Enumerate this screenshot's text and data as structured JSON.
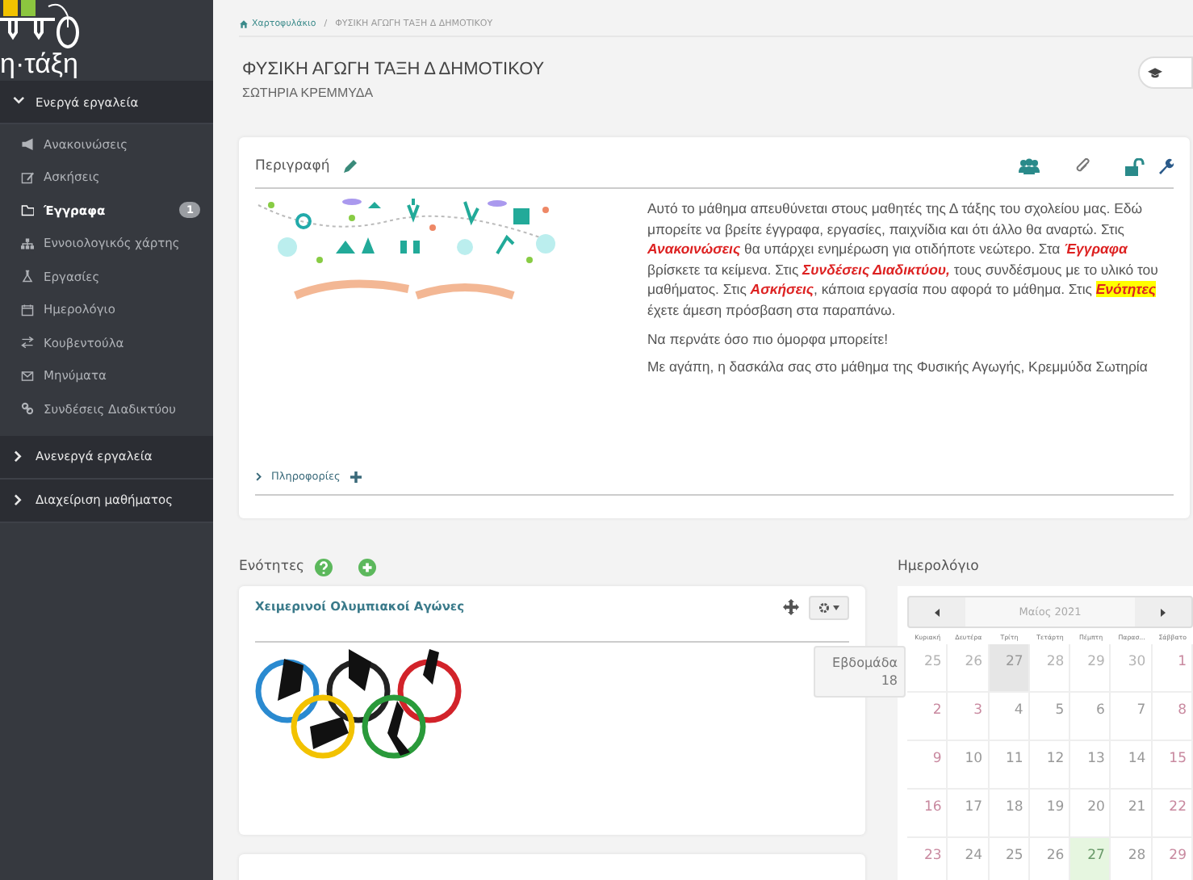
{
  "sidebar": {
    "logo_text": "η·τάξη",
    "sections": [
      {
        "label": "Ενεργά εργαλεία",
        "expanded": true,
        "items": [
          {
            "label": "Ανακοινώσεις",
            "selected": false
          },
          {
            "label": "Ασκήσεις",
            "selected": false
          },
          {
            "label": "Έγγραφα",
            "selected": true,
            "badge": "1"
          },
          {
            "label": "Εννοιολογικός χάρτης",
            "selected": false
          },
          {
            "label": "Εργασίες",
            "selected": false
          },
          {
            "label": "Ημερολόγιο",
            "selected": false
          },
          {
            "label": "Κουβεντούλα",
            "selected": false
          },
          {
            "label": "Μηνύματα",
            "selected": false
          },
          {
            "label": "Συνδέσεις Διαδικτύου",
            "selected": false
          }
        ]
      },
      {
        "label": "Ανενεργά εργαλεία",
        "expanded": false
      },
      {
        "label": "Διαχείριση μαθήματος",
        "expanded": false
      }
    ]
  },
  "breadcrumb": [
    {
      "label": "Χαρτοφυλάκιο"
    },
    {
      "label": "ΦΥΣΙΚΗ ΑΓΩΓΗ ΤΑΞΗ Δ ΔΗΜΟΤΙΚΟΥ",
      "separator": "/"
    }
  ],
  "student_view": {
    "on": false
  },
  "course": {
    "title": "ΦΥΣΙΚΗ ΑΓΩΓΗ ΤΑΞΗ Δ ΔΗΜΟΤΙΚΟΥ",
    "teacher": "ΣΩΤΗΡΙΑ ΚΡΕΜΜΥΔΑ"
  },
  "description": {
    "heading": "Περιγραφή",
    "paragraphs": [
      [
        {
          "kind": "plain",
          "text": "Αυτό το μάθημα απευθύνεται στους μαθητές της Δ τάξης του σχολείου μας. Εδώ μπορείτε να βρείτε έγγραφα, εργασίες, παιχνίδια και ότι άλλο θα αναρτώ. Στις "
        },
        {
          "kind": "emphasis",
          "text": "Ανακοινώσεις"
        },
        {
          "kind": "plain",
          "text": " θα υπάρχει ενημέρωση για οτιδήποτε νεώτερο. Στα "
        },
        {
          "kind": "emphasis",
          "text": "Έγγραφα"
        },
        {
          "kind": "plain",
          "text": " βρίσκετε τα κείμενα. Στις "
        },
        {
          "kind": "emphasis",
          "text": "Συνδέσεις Διαδικτύου,"
        },
        {
          "kind": "plain",
          "text": " τους συνδέσμους με το υλικό του μαθήματος. Στις "
        },
        {
          "kind": "emphasis",
          "text": "Ασκήσεις"
        },
        {
          "kind": "plain",
          "text": ", κάποια εργασία που αφορά το μάθημα. Στις "
        },
        {
          "kind": "highlight",
          "text": "Ενότητες"
        },
        {
          "kind": "plain",
          "text": " έχετε άμεση πρόσβαση στα παραπάνω."
        }
      ],
      [
        {
          "kind": "plain",
          "text": "Να περνάτε όσο πιο όμορφα μπορείτε!"
        }
      ],
      [
        {
          "kind": "plain",
          "text": " Με αγάπη, η δασκάλα σας στο μάθημα της Φυσικής Αγωγής, Κρεμμύδα Σωτηρία"
        }
      ]
    ],
    "info_label": "Πληροφορίες",
    "info_expanded": false
  },
  "units": {
    "heading": "Ενότητες",
    "items": [
      {
        "title": "Χειμερινοί Ολυμπιακοί Αγώνες"
      }
    ]
  },
  "calendar": {
    "heading": "Ημερολόγιο",
    "month": "Μαίος 2021",
    "weekdays": [
      "Κυριακή",
      "Δευτέρα",
      "Τρίτη",
      "Τετάρτη",
      "Πέμπτη",
      "Παρασ...",
      "Σάββατο"
    ],
    "weeks": [
      [
        {
          "day": "25",
          "other_month": true,
          "holiday": false,
          "shaded": false,
          "today": false
        },
        {
          "day": "26",
          "other_month": true,
          "holiday": false,
          "shaded": false,
          "today": false
        },
        {
          "day": "27",
          "other_month": true,
          "holiday": false,
          "shaded": true,
          "today": false
        },
        {
          "day": "28",
          "other_month": true,
          "holiday": false,
          "shaded": false,
          "today": false
        },
        {
          "day": "29",
          "other_month": true,
          "holiday": false,
          "shaded": false,
          "today": false
        },
        {
          "day": "30",
          "other_month": true,
          "holiday": false,
          "shaded": false,
          "today": false
        },
        {
          "day": "1",
          "other_month": false,
          "holiday": true,
          "shaded": false,
          "today": false
        }
      ],
      [
        {
          "day": "2",
          "other_month": false,
          "holiday": true,
          "shaded": false,
          "today": false
        },
        {
          "day": "3",
          "other_month": false,
          "holiday": true,
          "shaded": false,
          "today": false
        },
        {
          "day": "4",
          "other_month": false,
          "holiday": false,
          "shaded": false,
          "today": false
        },
        {
          "day": "5",
          "other_month": false,
          "holiday": false,
          "shaded": false,
          "today": false
        },
        {
          "day": "6",
          "other_month": false,
          "holiday": false,
          "shaded": false,
          "today": false
        },
        {
          "day": "7",
          "other_month": false,
          "holiday": false,
          "shaded": false,
          "today": false
        },
        {
          "day": "8",
          "other_month": false,
          "holiday": true,
          "shaded": false,
          "today": false
        }
      ],
      [
        {
          "day": "9",
          "other_month": false,
          "holiday": true,
          "shaded": false,
          "today": false
        },
        {
          "day": "10",
          "other_month": false,
          "holiday": false,
          "shaded": false,
          "today": false
        },
        {
          "day": "11",
          "other_month": false,
          "holiday": false,
          "shaded": false,
          "today": false
        },
        {
          "day": "12",
          "other_month": false,
          "holiday": false,
          "shaded": false,
          "today": false
        },
        {
          "day": "13",
          "other_month": false,
          "holiday": false,
          "shaded": false,
          "today": false
        },
        {
          "day": "14",
          "other_month": false,
          "holiday": false,
          "shaded": false,
          "today": false
        },
        {
          "day": "15",
          "other_month": false,
          "holiday": true,
          "shaded": false,
          "today": false
        }
      ],
      [
        {
          "day": "16",
          "other_month": false,
          "holiday": true,
          "shaded": false,
          "today": false
        },
        {
          "day": "17",
          "other_month": false,
          "holiday": false,
          "shaded": false,
          "today": false
        },
        {
          "day": "18",
          "other_month": false,
          "holiday": false,
          "shaded": false,
          "today": false
        },
        {
          "day": "19",
          "other_month": false,
          "holiday": false,
          "shaded": false,
          "today": false
        },
        {
          "day": "20",
          "other_month": false,
          "holiday": false,
          "shaded": false,
          "today": false
        },
        {
          "day": "21",
          "other_month": false,
          "holiday": false,
          "shaded": false,
          "today": false
        },
        {
          "day": "22",
          "other_month": false,
          "holiday": true,
          "shaded": false,
          "today": false
        }
      ],
      [
        {
          "day": "23",
          "other_month": false,
          "holiday": true,
          "shaded": false,
          "today": false
        },
        {
          "day": "24",
          "other_month": false,
          "holiday": false,
          "shaded": false,
          "today": false
        },
        {
          "day": "25",
          "other_month": false,
          "holiday": false,
          "shaded": false,
          "today": false
        },
        {
          "day": "26",
          "other_month": false,
          "holiday": false,
          "shaded": false,
          "today": false
        },
        {
          "day": "27",
          "other_month": false,
          "holiday": false,
          "shaded": false,
          "today": true
        },
        {
          "day": "28",
          "other_month": false,
          "holiday": false,
          "shaded": false,
          "today": false
        },
        {
          "day": "29",
          "other_month": false,
          "holiday": true,
          "shaded": false,
          "today": false
        }
      ]
    ],
    "tooltip": "Εβδομάδα 18"
  }
}
